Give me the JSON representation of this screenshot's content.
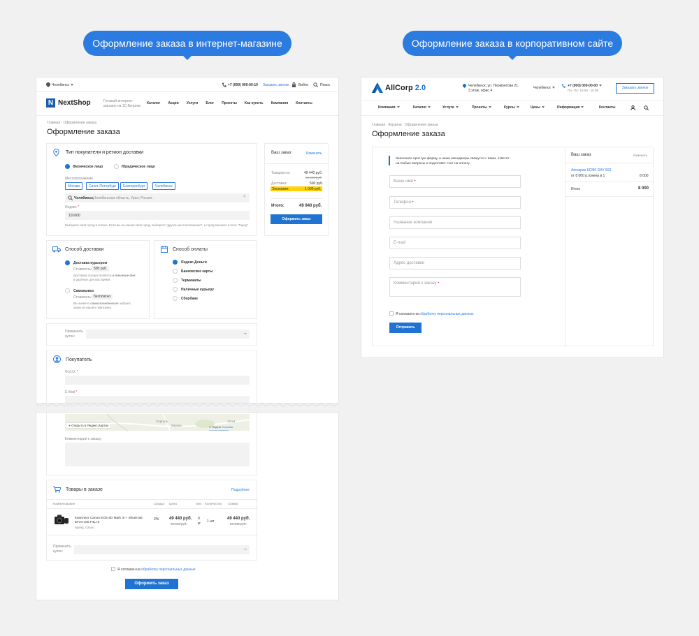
{
  "captions": {
    "left": "Оформление заказа в интернет-магазине",
    "right": "Оформление заказа в корпоративном сайте"
  },
  "nextshop": {
    "top": {
      "city": "Челябинск",
      "phone": "+7 (000) 000-00-10",
      "callback": "Заказать звонок",
      "login": "Войти",
      "search": "Поиск"
    },
    "logo": "NextShop",
    "tagline_1": "Готовый интернет-",
    "tagline_2": "магазин на 1С-Битрикс",
    "menu": [
      "Каталог",
      "Акции",
      "Услуги",
      "Блог",
      "Проекты",
      "Как купить",
      "Компания",
      "Контакты"
    ],
    "breadcrumb": "Главная · Оформление заказа",
    "title": "Оформление заказа",
    "buyer_section": {
      "title": "Тип покупателя и регион доставки",
      "options": [
        "Физическое лицо",
        "Юридическое лицо"
      ],
      "location_label": "Местоположение",
      "cities": [
        "Москва",
        "Санкт-Петербург",
        "Екатеринбург",
        "Челябинск"
      ],
      "location_value": "Челябинск,",
      "location_rest": "Челябинская область, Урал, Россия",
      "zip_label": "Индекс",
      "zip_value": "101000",
      "hint": "Выберите свой город в списке. Если вы не нашли свой город, выберите \"другое местоположение\", а город впишите в поле \"Город\""
    },
    "delivery": {
      "title": "Способ доставки",
      "courier": "Доставка курьером",
      "courier_cost_label": "Стоимость:",
      "courier_cost": "500 руб.",
      "courier_note_1": "Доставка осуществляется",
      "courier_note_em": "в течение дня",
      "courier_note_2": "в удобное для вас время.",
      "pickup": "Самовывоз",
      "pickup_cost_label": "Стоимость:",
      "pickup_cost": "бесплатно",
      "pickup_note_1": "Вы можете",
      "pickup_note_em": "самостоятельно",
      "pickup_note_2": "забрать",
      "pickup_note_3": "заказ из нашего магазина."
    },
    "payment": {
      "title": "Способ оплаты",
      "options": [
        "Яндекс.Деньги",
        "Банковские карты",
        "Терминалы",
        "Наличные курьеру",
        "Сбербанк"
      ]
    },
    "coupon": {
      "label_1": "Применить",
      "label_2": "купон:"
    },
    "buyer": {
      "title": "Покупатель",
      "name_label": "Ф.И.О.",
      "email_label": "E-Mail"
    },
    "map": {
      "open": "Открыть в Яндекс.Картах",
      "city_1": "Сергуль",
      "city_2": "Кирово",
      "scale": "10 км",
      "copyright": "© Яндекс",
      "terms": "Условия использования"
    },
    "comment_label": "Комментарии к заказу:",
    "goods": {
      "title": "Товары в заказе",
      "more": "Подробнее",
      "headers": [
        "Наименование",
        "Скидка",
        "Цена",
        "Вес",
        "Количество",
        "Сумма"
      ],
      "item_name_1": "Комплект Canon EOS 5D Mark III + объектив",
      "item_name_2": "EF24-105 F4L IS",
      "item_brand": "Бренд: Canon",
      "discount": "2%",
      "price": "49 440 руб.",
      "price_old": "50 440 руб.",
      "weight_1": "0",
      "weight_2": "кг",
      "qty": "1 шт",
      "sum": "49 440 руб.",
      "sum_old": "50 440 руб."
    },
    "agree_text": "Я согласен на",
    "agree_link": "обработку персональных данных",
    "submit": "Оформить заказ",
    "summary": {
      "title": "Ваш заказ",
      "change": "Изменить",
      "goods_label": "Товаров на:",
      "goods_value": "49 440 руб.",
      "goods_old": "50 440 руб.",
      "delivery_label": "Доставка:",
      "delivery_value": "500 руб.",
      "economy_label": "Экономия:",
      "economy_value": "1 000 руб.",
      "total_label": "Итого:",
      "total_value": "49 940 руб.",
      "button": "Оформить заказ"
    }
  },
  "allcorp": {
    "logo": "AllCorp",
    "logo_version": "2.0",
    "address_1": "Челябинск, ул. Пермонтова 21,",
    "address_2": "3 этаж, офис 4",
    "city": "Челябинск",
    "phone": "+7 (000) 000-00-00",
    "hours": "Пн - Вс: 10.00 - 18.00",
    "callback": "Заказать звонок",
    "menu": [
      "Компания",
      "Каталог",
      "Услуги",
      "Проекты",
      "Курсы",
      "Цены",
      "Информация",
      "Контакты"
    ],
    "menu_dropdown": [
      true,
      true,
      true,
      true,
      true,
      true,
      true,
      false
    ],
    "breadcrumb": "Главная · Корзина · Оформление заказа",
    "title": "Оформление заказа",
    "intro_1": "Заполните простую форму, и наши менеджеры свяжутся с вами, ответят",
    "intro_2": "на любые вопросы и подготовят счет на оплату.",
    "fields": [
      {
        "label": "Ваше имя",
        "req": true
      },
      {
        "label": "Телефон",
        "req": true
      },
      {
        "label": "Название компании",
        "req": false
      },
      {
        "label": "E-mail",
        "req": false
      },
      {
        "label": "Адрес доставки",
        "req": false
      },
      {
        "label": "Комментарий к заказу",
        "req": true
      }
    ],
    "agree_text": "Я согласен на",
    "agree_link": "обработку персональных данных",
    "submit": "Отправить",
    "summary": {
      "title": "Ваш заказ",
      "change": "Изменить",
      "item_name": "Автокран КСМ0 GAY 500",
      "item_detail": "от 8 000 р./смена в 1",
      "item_sum": "8 000",
      "total_label": "Итого",
      "total_value": "8 000"
    }
  }
}
